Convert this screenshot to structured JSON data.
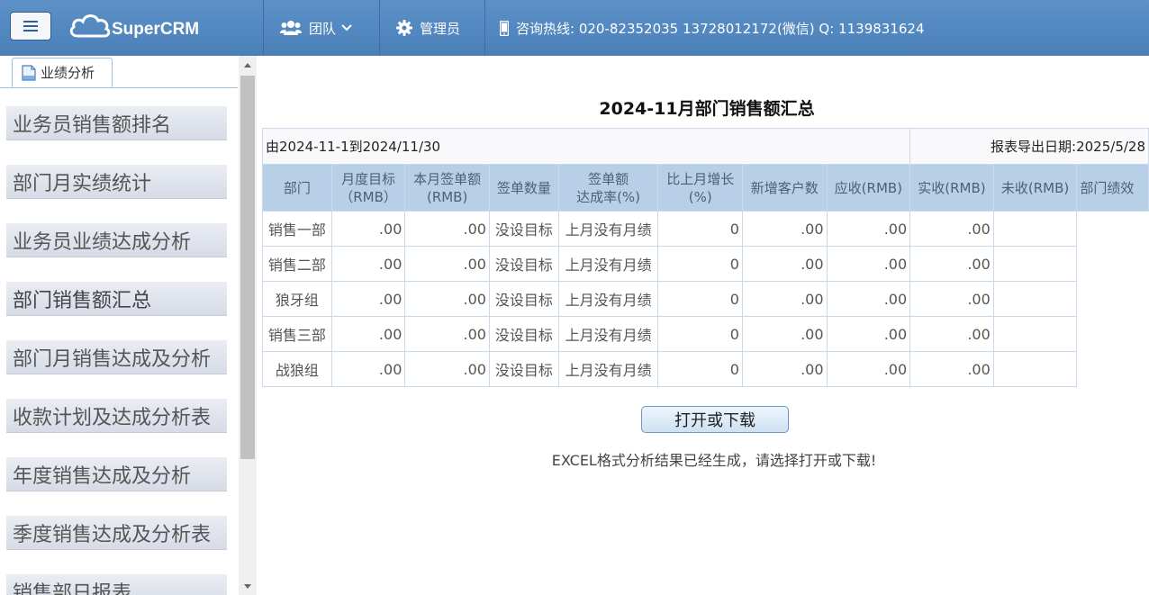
{
  "header": {
    "logo_text": "SuperCRM",
    "team_label": "团队",
    "admin_label": "管理员",
    "hotline": "咨询热线: 020-82352035 13728012172(微信) Q: 1139831624"
  },
  "sidebar": {
    "tab_label": "业绩分析",
    "items": [
      "业务员销售额排名",
      "部门月实绩统计",
      "业务员业绩达成分析",
      "部门销售额汇总",
      "部门月销售达成及分析",
      "收款计划及达成分析表",
      "年度销售达成及分析",
      "季度销售达成及分析表",
      "销售部日报表"
    ]
  },
  "report": {
    "title": "2024-11月部门销售额汇总",
    "range_text": "由2024-11-1到2024/11/30",
    "export_date": "报表导出日期:2025/5/28",
    "headers": [
      {
        "l1": "部门",
        "l2": ""
      },
      {
        "l1": "月度目标",
        "l2": "（RMB）"
      },
      {
        "l1": "本月签单额",
        "l2": "(RMB)"
      },
      {
        "l1": "签单数量",
        "l2": ""
      },
      {
        "l1": "签单额",
        "l2": "达成率(%)"
      },
      {
        "l1": "比上月增长",
        "l2": "(%)"
      },
      {
        "l1": "新增客户数",
        "l2": ""
      },
      {
        "l1": "应收(RMB)",
        "l2": ""
      },
      {
        "l1": "实收(RMB)",
        "l2": ""
      },
      {
        "l1": "未收(RMB)",
        "l2": ""
      },
      {
        "l1": "部门绩效",
        "l2": ""
      }
    ],
    "rows": [
      {
        "dept": "销售一部",
        "target": ".00",
        "signed": ".00",
        "count": "没设目标",
        "rate": "上月没有月绩",
        "growth": "0",
        "new_clients": ".00",
        "receivable": ".00",
        "received": ".00",
        "unreceived": ""
      },
      {
        "dept": "销售二部",
        "target": ".00",
        "signed": ".00",
        "count": "没设目标",
        "rate": "上月没有月绩",
        "growth": "0",
        "new_clients": ".00",
        "receivable": ".00",
        "received": ".00",
        "unreceived": ""
      },
      {
        "dept": "狼牙组",
        "target": ".00",
        "signed": ".00",
        "count": "没设目标",
        "rate": "上月没有月绩",
        "growth": "0",
        "new_clients": ".00",
        "receivable": ".00",
        "received": ".00",
        "unreceived": ""
      },
      {
        "dept": "销售三部",
        "target": ".00",
        "signed": ".00",
        "count": "没设目标",
        "rate": "上月没有月绩",
        "growth": "0",
        "new_clients": ".00",
        "receivable": ".00",
        "received": ".00",
        "unreceived": ""
      },
      {
        "dept": "战狼组",
        "target": ".00",
        "signed": ".00",
        "count": "没设目标",
        "rate": "上月没有月绩",
        "growth": "0",
        "new_clients": ".00",
        "receivable": ".00",
        "received": ".00",
        "unreceived": ""
      }
    ],
    "download_button": "打开或下载",
    "download_message": "EXCEL格式分析结果已经生成，请选择打开或下载!"
  },
  "colors": {
    "topbar": "#4a7fb8",
    "table_header": "#b8cfe8",
    "menu_item": "#dfe3ec"
  },
  "icons": {
    "menu": "hamburger-icon",
    "logo": "cloud-icon",
    "team": "users-icon",
    "admin": "gear-icon",
    "hotline": "mobile-phone-icon",
    "tab": "document-icon"
  }
}
